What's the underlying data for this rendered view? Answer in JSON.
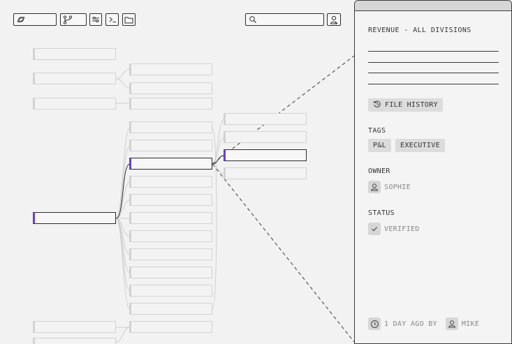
{
  "toolbar": {
    "left_icons": [
      "planet-icon",
      "branch-icon",
      "sliders-icon",
      "terminal-icon",
      "folder-icon"
    ],
    "search_placeholder": "",
    "right_icons": [
      "search-icon",
      "user-icon"
    ]
  },
  "panel": {
    "title": "REVENUE - ALL DIVISIONS",
    "file_history_label": "FILE HISTORY",
    "tags_label": "TAGS",
    "tags": [
      "P&L",
      "EXECUTIVE"
    ],
    "owner_label": "OWNER",
    "owner_name": "SOPHIE",
    "status_label": "STATUS",
    "status_value": "VERIFIED",
    "footer_time": "1 DAY AGO BY",
    "footer_user": "MIKE"
  },
  "colors": {
    "accent": "#6a3fd6",
    "border": "#2e2e2e",
    "node_border": "#d2d2d2",
    "chip": "#dcdcdc"
  }
}
